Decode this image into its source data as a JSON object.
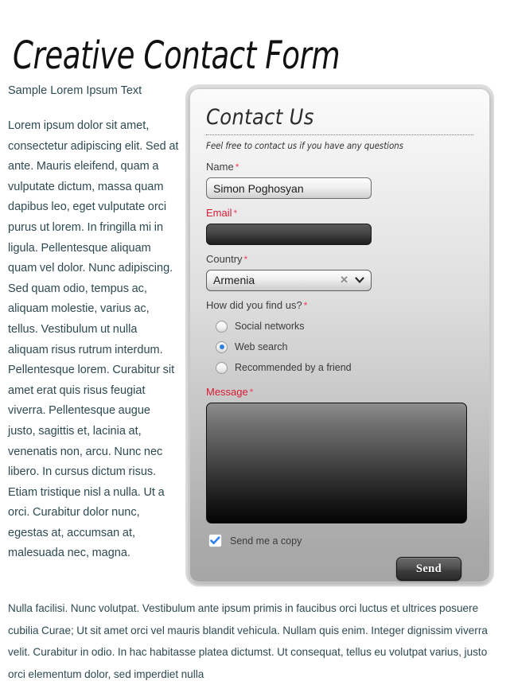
{
  "page": {
    "title": "Creative Contact Form"
  },
  "left_column": {
    "heading": "Sample Lorem Ipsum Text",
    "body": "Lorem ipsum dolor sit amet, consectetur adipiscing elit. Sed at ante. Mauris eleifend, quam a vulputate dictum, massa quam dapibus leo, eget vulputate orci purus ut lorem. In fringilla mi in ligula. Pellentesque aliquam quam vel dolor. Nunc adipiscing. Sed quam odio, tempus ac, aliquam molestie, varius ac, tellus. Vestibulum ut nulla aliquam risus rutrum interdum. Pellentesque lorem. Curabitur sit amet erat quis risus feugiat viverra. Pellentesque augue justo, sagittis et, lacinia at, venenatis non, arcu. Nunc nec libero. In cursus dictum risus. Etiam tristique nisl a nulla. Ut a orci. Curabitur dolor nunc, egestas at, accumsan at, malesuada nec, magna."
  },
  "bottom_paragraph": "Nulla facilisi. Nunc volutpat. Vestibulum ante ipsum primis in faucibus orci luctus et ultrices posuere cubilia Curae; Ut sit amet orci vel mauris blandit vehicula. Nullam quis enim. Integer dignissim viverra velit. Curabitur in odio. In hac habitasse platea dictumst. Ut consequat, tellus eu volutpat varius, justo orci elementum dolor, sed imperdiet nulla",
  "form": {
    "heading": "Contact Us",
    "subtitle": "Feel free to contact us if you have any questions",
    "required_marker": "*",
    "fields": {
      "name": {
        "label": "Name",
        "value": "Simon Poghosyan",
        "placeholder": "",
        "state": "valid"
      },
      "email": {
        "label": "Email",
        "value": "",
        "placeholder": "",
        "state": "error"
      },
      "country": {
        "label": "Country",
        "value": "Armenia",
        "clear_icon": "clear-x-icon",
        "caret_icon": "chevron-down-icon",
        "state": "valid"
      },
      "find_us": {
        "label": "How did you find us?",
        "options": [
          {
            "label": "Social networks",
            "selected": false
          },
          {
            "label": "Web search",
            "selected": true
          },
          {
            "label": "Recommended by a friend",
            "selected": false
          }
        ]
      },
      "message": {
        "label": "Message",
        "value": "",
        "placeholder": "",
        "state": "error"
      },
      "send_copy": {
        "label": "Send me a copy",
        "checked": true
      }
    },
    "submit_label": "Send"
  },
  "colors": {
    "error_label": "#d81b34",
    "required_star": "#ef4060",
    "body_text": "#2e4a52",
    "radio_selected": "#2f7fe0",
    "checkbox_check": "#2f80ed",
    "panel_top": "#fbfbfb",
    "panel_bottom": "#a6a6a6"
  }
}
